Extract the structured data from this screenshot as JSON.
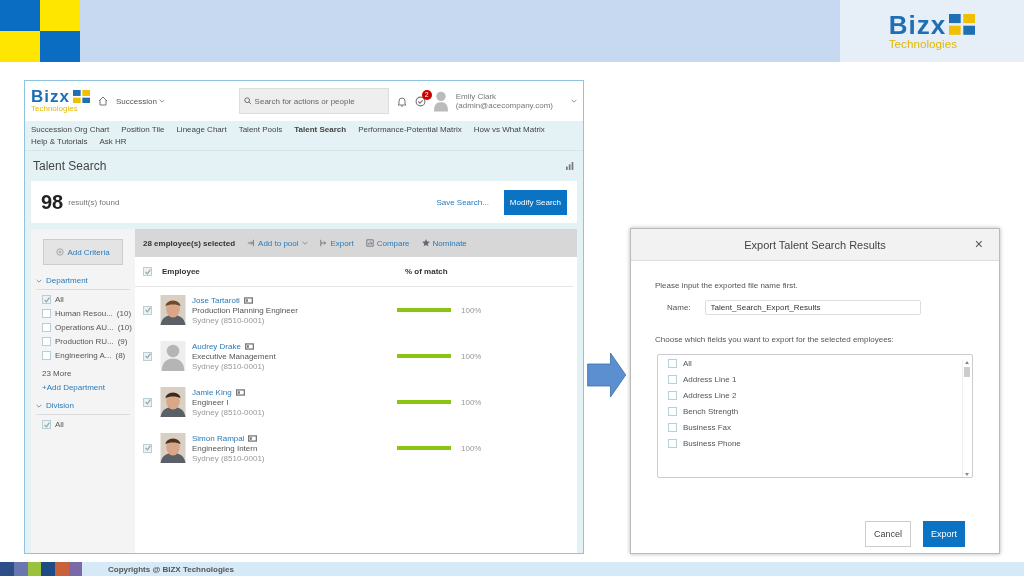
{
  "slide_logo": {
    "word": "Bizx",
    "tagline": "Technologies"
  },
  "app": {
    "logo": {
      "word": "Bizx",
      "tagline": "Technologies"
    },
    "module_menu": "Succession",
    "search": {
      "placeholder": "Search for actions or people"
    },
    "todo_badge": "2",
    "user": {
      "name": "Emily Clark",
      "email": "(admin@acecompany.com)"
    },
    "nav": [
      {
        "label": "Succession Org Chart",
        "selected": false
      },
      {
        "label": "Position Tile",
        "selected": false
      },
      {
        "label": "Lineage Chart",
        "selected": false
      },
      {
        "label": "Talent Pools",
        "selected": false
      },
      {
        "label": "Talent Search",
        "selected": true
      },
      {
        "label": "Performance-Potential Matrix",
        "selected": false
      },
      {
        "label": "How vs What Matrix",
        "selected": false
      },
      {
        "label": "Help & Tutorials",
        "selected": false
      },
      {
        "label": "Ask HR",
        "selected": false
      }
    ],
    "page_title": "Talent Search",
    "results": {
      "count": "98",
      "label": "result(s) found",
      "save": "Save Search...",
      "modify": "Modify Search"
    },
    "sidebar": {
      "add_criteria": "Add Criteria",
      "groups": [
        {
          "title": "Department",
          "expanded": true,
          "items": [
            {
              "label": "All",
              "checked": true
            },
            {
              "label": "Human Resou...",
              "count": "(10)",
              "checked": false
            },
            {
              "label": "Operations AU...",
              "count": "(10)",
              "checked": false
            },
            {
              "label": "Production RU...",
              "count": "(9)",
              "checked": false
            },
            {
              "label": "Engineering A...",
              "count": "(8)",
              "checked": false
            }
          ],
          "more": "23 More",
          "add": "+Add Department"
        },
        {
          "title": "Division",
          "expanded": true,
          "items": [
            {
              "label": "All",
              "checked": true
            }
          ]
        }
      ]
    },
    "toolbar": {
      "selected_count": "28 employee(s) selected",
      "actions": [
        "Add to pool",
        "Export",
        "Compare",
        "Nominate"
      ]
    },
    "table": {
      "all_checked": true,
      "columns": [
        "Employee",
        "% of match"
      ],
      "rows": [
        {
          "name": "Jose Tartaroti",
          "title": "Production Planning Engineer",
          "location": "Sydney (8510-0001)",
          "checked": true,
          "level": 1,
          "reading": "100%"
        },
        {
          "name": "Audrey Drake",
          "title": "Executive Management",
          "location": "Sydney (8510-0001)",
          "checked": true,
          "kind": "silhouette",
          "level": 1,
          "reading": "100%"
        },
        {
          "name": "Jamie King",
          "title": "Engineer I",
          "location": "Sydney (8510-0001)",
          "checked": true,
          "level": 1,
          "reading": "100%"
        },
        {
          "name": "Simon Rampal",
          "title": "Engineering Intern",
          "location": "Sydney (8510-0001)",
          "checked": true,
          "level": 1,
          "reading": "100%"
        }
      ]
    }
  },
  "dialog": {
    "title": "Export Talent Search Results",
    "close": "×",
    "prompt": "Please input the exported file name first.",
    "name_label": "Name:",
    "name_value": "Talent_Search_Export_Results",
    "fields_prompt": "Choose which fields you want to export for the selected employees:",
    "fields": [
      {
        "label": "All",
        "checked": false
      },
      {
        "label": "Address Line 1",
        "checked": false
      },
      {
        "label": "Address Line 2",
        "checked": false
      },
      {
        "label": "Bench Strength",
        "checked": false
      },
      {
        "label": "Business Fax",
        "checked": false
      },
      {
        "label": "Business Phone",
        "checked": false
      }
    ],
    "buttons": [
      {
        "label": "Cancel",
        "kind": "secondary"
      },
      {
        "label": "Export",
        "kind": "primary"
      }
    ]
  },
  "footer": "Copyrights @ BIZX Technologies"
}
